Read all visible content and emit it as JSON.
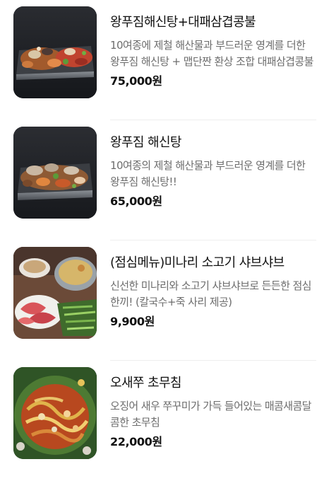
{
  "menu": {
    "items": [
      {
        "name": "왕푸짐해신탕+대패삼겹콩불",
        "description": "10여종에 제철 해산물과 부드러운 영계를 더한 왕푸짐 해신탕 + 맵단짠 환상 조합 대패삼겹콩불",
        "price": "75,000원",
        "image": "seafood-stew-combo-photo"
      },
      {
        "name": "왕푸짐 해신탕",
        "description": "10여종의 제철 해산물과 부드러운 영계를 더한 왕푸짐 해신탕!!",
        "price": "65,000원",
        "image": "seafood-stew-photo"
      },
      {
        "name": "(점심메뉴)미나리 소고기 샤브샤브",
        "description": "신선한 미나리와 소고기 샤브샤브로 든든한 점심 한끼! (칼국수+죽 사리 제공)",
        "price": "9,900원",
        "image": "shabu-shabu-photo"
      },
      {
        "name": "오새쭈 초무침",
        "description": "오징어 새우 쭈꾸미가 가득 들어있는 매콤새콤달콤한 초무침",
        "price": "22,000원",
        "image": "spicy-seafood-salad-photo"
      }
    ]
  }
}
